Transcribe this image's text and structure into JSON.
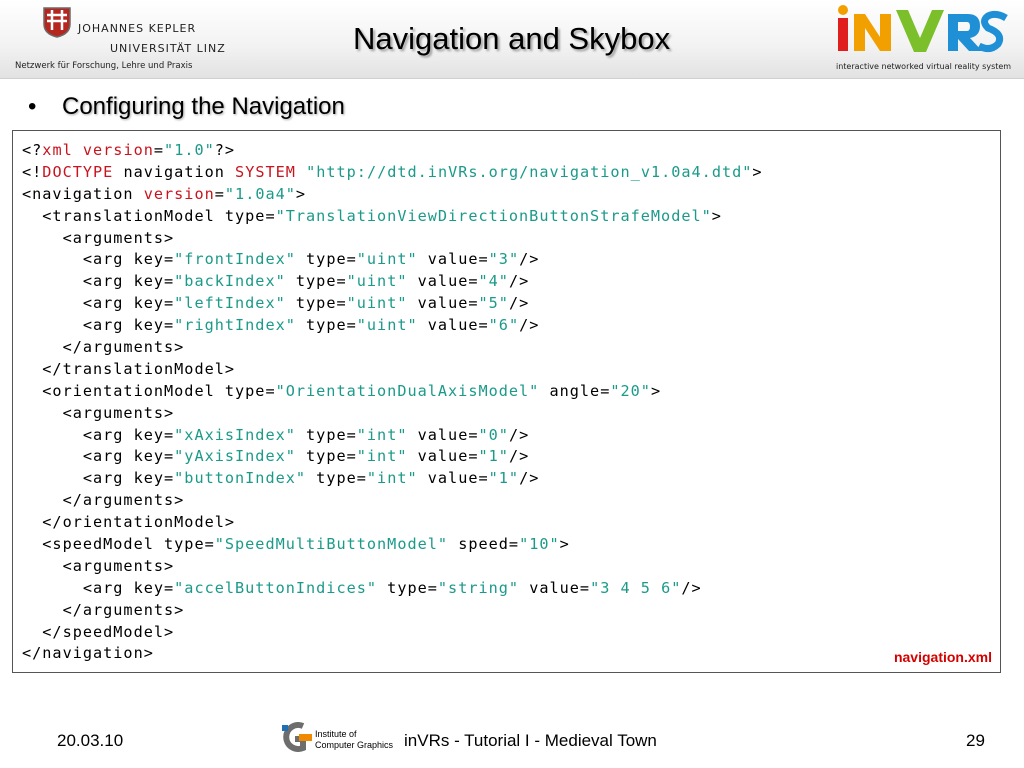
{
  "header": {
    "university_line1": "JOHANNES KEPLER",
    "university_line2": "UNIVERSITÄT LINZ",
    "university_tagline": "Netzwerk für Forschung, Lehre und Praxis",
    "title": "Navigation and Skybox",
    "invrs_logo_text": "iNVRS",
    "invrs_tagline": "interactive networked virtual reality system"
  },
  "bullet": {
    "symbol": "•",
    "text": "Configuring the Navigation"
  },
  "code": {
    "filename": "navigation.xml",
    "lines": [
      [
        [
          "t",
          "<?"
        ],
        [
          "k",
          "xml version"
        ],
        [
          "t",
          "="
        ],
        [
          "s",
          "\"1.0\""
        ],
        [
          "t",
          "?>"
        ]
      ],
      [
        [
          "t",
          "<!"
        ],
        [
          "k",
          "DOCTYPE"
        ],
        [
          "t",
          " navigation "
        ],
        [
          "k",
          "SYSTEM"
        ],
        [
          "t",
          " "
        ],
        [
          "s",
          "\"http://dtd.inVRs.org/navigation_v1.0a4.dtd\""
        ],
        [
          "t",
          ">"
        ]
      ],
      [
        [
          "t",
          "<navigation "
        ],
        [
          "k",
          "version"
        ],
        [
          "t",
          "="
        ],
        [
          "s",
          "\"1.0a4\""
        ],
        [
          "t",
          ">"
        ]
      ],
      [
        [
          "t",
          "  <translationModel type="
        ],
        [
          "s",
          "\"TranslationViewDirectionButtonStrafeModel\""
        ],
        [
          "t",
          ">"
        ]
      ],
      [
        [
          "t",
          "    <arguments>"
        ]
      ],
      [
        [
          "t",
          "      <arg key="
        ],
        [
          "s",
          "\"frontIndex\""
        ],
        [
          "t",
          " type="
        ],
        [
          "s",
          "\"uint\""
        ],
        [
          "t",
          " value="
        ],
        [
          "s",
          "\"3\""
        ],
        [
          "t",
          "/>"
        ]
      ],
      [
        [
          "t",
          "      <arg key="
        ],
        [
          "s",
          "\"backIndex\""
        ],
        [
          "t",
          " type="
        ],
        [
          "s",
          "\"uint\""
        ],
        [
          "t",
          " value="
        ],
        [
          "s",
          "\"4\""
        ],
        [
          "t",
          "/>"
        ]
      ],
      [
        [
          "t",
          "      <arg key="
        ],
        [
          "s",
          "\"leftIndex\""
        ],
        [
          "t",
          " type="
        ],
        [
          "s",
          "\"uint\""
        ],
        [
          "t",
          " value="
        ],
        [
          "s",
          "\"5\""
        ],
        [
          "t",
          "/>"
        ]
      ],
      [
        [
          "t",
          "      <arg key="
        ],
        [
          "s",
          "\"rightIndex\""
        ],
        [
          "t",
          " type="
        ],
        [
          "s",
          "\"uint\""
        ],
        [
          "t",
          " value="
        ],
        [
          "s",
          "\"6\""
        ],
        [
          "t",
          "/>"
        ]
      ],
      [
        [
          "t",
          "    </arguments>"
        ]
      ],
      [
        [
          "t",
          "  </translationModel>"
        ]
      ],
      [
        [
          "t",
          "  <orientationModel type="
        ],
        [
          "s",
          "\"OrientationDualAxisModel\""
        ],
        [
          "t",
          " angle="
        ],
        [
          "s",
          "\"20\""
        ],
        [
          "t",
          ">"
        ]
      ],
      [
        [
          "t",
          "    <arguments>"
        ]
      ],
      [
        [
          "t",
          "      <arg key="
        ],
        [
          "s",
          "\"xAxisIndex\""
        ],
        [
          "t",
          " type="
        ],
        [
          "s",
          "\"int\""
        ],
        [
          "t",
          " value="
        ],
        [
          "s",
          "\"0\""
        ],
        [
          "t",
          "/>"
        ]
      ],
      [
        [
          "t",
          "      <arg key="
        ],
        [
          "s",
          "\"yAxisIndex\""
        ],
        [
          "t",
          " type="
        ],
        [
          "s",
          "\"int\""
        ],
        [
          "t",
          " value="
        ],
        [
          "s",
          "\"1\""
        ],
        [
          "t",
          "/>"
        ]
      ],
      [
        [
          "t",
          "      <arg key="
        ],
        [
          "s",
          "\"buttonIndex\""
        ],
        [
          "t",
          " type="
        ],
        [
          "s",
          "\"int\""
        ],
        [
          "t",
          " value="
        ],
        [
          "s",
          "\"1\""
        ],
        [
          "t",
          "/>"
        ]
      ],
      [
        [
          "t",
          "    </arguments>"
        ]
      ],
      [
        [
          "t",
          "  </orientationModel>"
        ]
      ],
      [
        [
          "t",
          "  <speedModel type="
        ],
        [
          "s",
          "\"SpeedMultiButtonModel\""
        ],
        [
          "t",
          " speed="
        ],
        [
          "s",
          "\"10\""
        ],
        [
          "t",
          ">"
        ]
      ],
      [
        [
          "t",
          "    <arguments>"
        ]
      ],
      [
        [
          "t",
          "      <arg key="
        ],
        [
          "s",
          "\"accelButtonIndices\""
        ],
        [
          "t",
          " type="
        ],
        [
          "s",
          "\"string\""
        ],
        [
          "t",
          " value="
        ],
        [
          "s",
          "\"3 4 5 6\""
        ],
        [
          "t",
          "/>"
        ]
      ],
      [
        [
          "t",
          "    </arguments>"
        ]
      ],
      [
        [
          "t",
          "  </speedModel>"
        ]
      ],
      [
        [
          "t",
          "</navigation>"
        ]
      ]
    ]
  },
  "footer": {
    "date": "20.03.10",
    "institute_line1": "Institute of",
    "institute_line2": "Computer Graphics",
    "center_text": "inVRs - Tutorial I - Medieval Town",
    "page_number": "29"
  },
  "colors": {
    "keyword": "#c8141e",
    "string": "#1b9a8a",
    "filename": "#d40000"
  }
}
